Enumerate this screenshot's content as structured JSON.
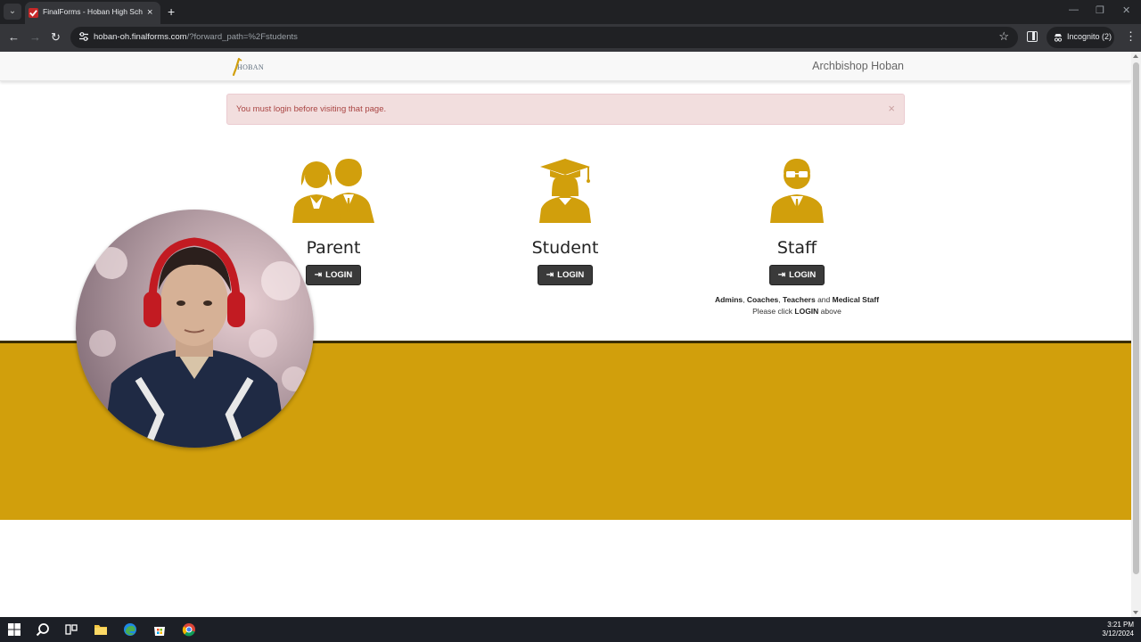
{
  "browser": {
    "tab_title": "FinalForms - Hoban High School",
    "tab_close": "×",
    "new_tab": "+",
    "url_host": "hoban-oh.finalforms.com",
    "url_path": "/?forward_path=%2Fstudents",
    "incognito_label": "Incognito (2)",
    "back": "←",
    "forward": "→",
    "reload": "↻",
    "star": "☆",
    "menu": "⋮",
    "min": "—",
    "restore": "❐",
    "close": "✕",
    "tab_menu": "⌄"
  },
  "header": {
    "logo_text": "HOBAN",
    "org_name": "Archbishop Hoban"
  },
  "alert": {
    "message": "You must login before visiting that page.",
    "close": "×"
  },
  "roles": [
    {
      "title": "Parent",
      "login_label": "LOGIN"
    },
    {
      "title": "Student",
      "login_label": "LOGIN"
    },
    {
      "title": "Staff",
      "login_label": "LOGIN"
    }
  ],
  "staff_note": {
    "admins": "Admins",
    "comma1": ", ",
    "coaches": "Coaches",
    "comma2": ", ",
    "teachers": "Teachers",
    "and": " and ",
    "medical": "Medical Staff",
    "line2_pre": "Please click ",
    "line2_login": "LOGIN",
    "line2_post": " above"
  },
  "colors": {
    "brand_gold": "#d19f0c",
    "alert_bg": "#f2dede",
    "alert_text": "#a94442",
    "button_dark": "#3a3a3a"
  },
  "taskbar": {
    "time": "3:21 PM",
    "date": "3/12/2024",
    "icons": [
      "windows-start-icon",
      "search-icon",
      "task-view-icon",
      "file-explorer-icon",
      "edge-icon",
      "store-icon",
      "chrome-icon"
    ]
  }
}
